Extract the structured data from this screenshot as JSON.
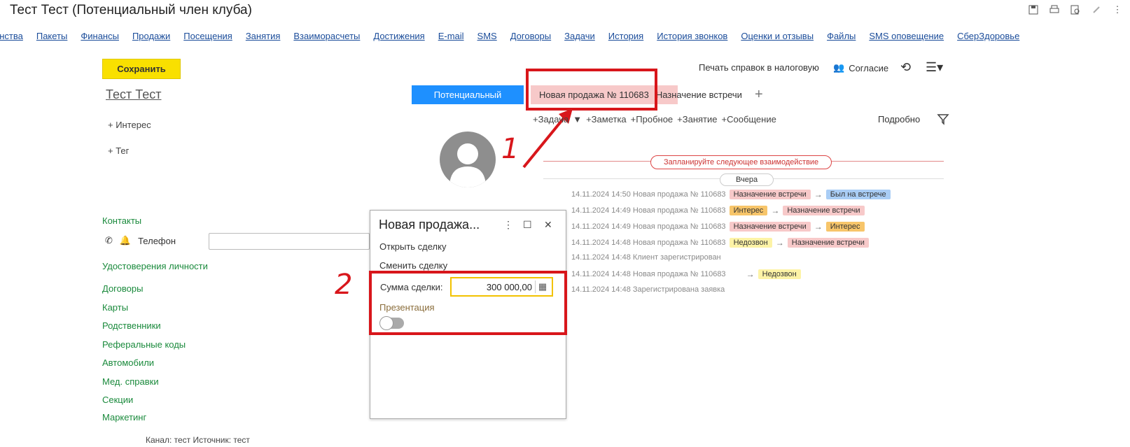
{
  "window": {
    "title": "Тест Тест (Потенциальный член клуба)"
  },
  "nav_tabs": [
    "енства",
    "Пакеты",
    "Финансы",
    "Продажи",
    "Посещения",
    "Занятия",
    "Взаиморасчеты",
    "Достижения",
    "E-mail",
    "SMS",
    "Договоры",
    "Задачи",
    "История",
    "История звонков",
    "Оценки и отзывы",
    "Файлы",
    "SMS оповещение",
    "СберЗдоровье"
  ],
  "toolbar": {
    "save_label": "Сохранить",
    "print_label": "Печать справок в налоговую",
    "consent_label": "Согласие"
  },
  "client": {
    "name": "Тест Тест",
    "add_interest": "+ Интерес",
    "add_tag": "+ Тег"
  },
  "status_tabs": {
    "potential": "Потенциальный",
    "sale": "Новая продажа № 110683",
    "sale_stage": "Назначение встречи"
  },
  "actions": {
    "task": "+Задача",
    "note": "+Заметка",
    "trial": "+Пробное",
    "lesson": "+Занятие",
    "message": "+Сообщение",
    "details": "Подробно"
  },
  "timeline": {
    "plan_label": "Запланируйте следующее взаимодействие",
    "day_label": "Вчера",
    "rows": [
      {
        "text": "14.11.2024 14:50 Новая продажа № 110683",
        "from": "Назначение встречи",
        "from_color": "#f7c9c9",
        "to": "Был на встрече",
        "to_color": "#a9cdf5"
      },
      {
        "text": "14.11.2024 14:49 Новая продажа № 110683",
        "from": "Интерес",
        "from_color": "#f7c56a",
        "to": "Назначение встречи",
        "to_color": "#f7c9c9"
      },
      {
        "text": "14.11.2024 14:49 Новая продажа № 110683",
        "from": "Назначение встречи",
        "from_color": "#f7c9c9",
        "to": "Интерес",
        "to_color": "#f7c56a"
      },
      {
        "text": "14.11.2024 14:48 Новая продажа № 110683",
        "from": "Недозвон",
        "from_color": "#fdf3a6",
        "to": "Назначение встречи",
        "to_color": "#f7c9c9"
      },
      {
        "text": "14.11.2024 14:48 Клиент зарегистрирован"
      },
      {
        "text": "14.11.2024 14:48 Новая продажа № 110683",
        "to": "Недозвон",
        "to_color": "#fdf3a6"
      },
      {
        "text": "14.11.2024 14:48 Зарегистрирована заявка"
      }
    ]
  },
  "left_panel": {
    "contacts": "Контакты",
    "phone_label": "Телефон",
    "links": [
      "Удостоверения личности",
      "Договоры",
      "Карты",
      "Родственники",
      "Реферальные коды",
      "Автомобили",
      "Мед. справки",
      "Секции",
      "Маркетинг"
    ],
    "channel": "Канал: тест Источник: тест"
  },
  "popup": {
    "title": "Новая продажа...",
    "open_deal": "Открыть сделку",
    "change_deal": "Сменить сделку",
    "sum_label": "Сумма сделки:",
    "sum_value": "300 000,00",
    "presentation_label": "Презентация",
    "presentation_on": false
  },
  "annotations": {
    "mark1": "1",
    "mark2": "2",
    "color": "#d8161b"
  }
}
